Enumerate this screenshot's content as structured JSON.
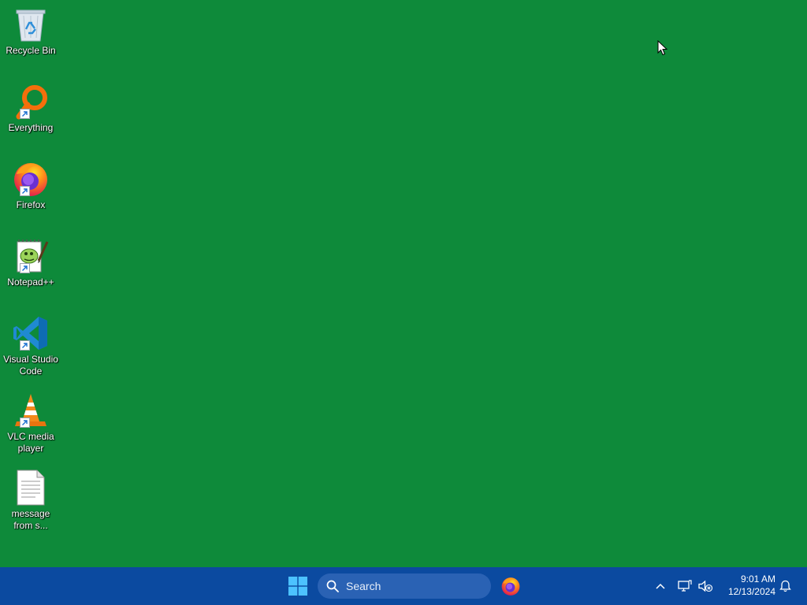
{
  "desktop": {
    "background_color": "#0e8a3a",
    "icons": [
      {
        "label": "Recycle Bin",
        "icon": "recycle-bin-icon",
        "shortcut": false
      },
      {
        "label": "Everything",
        "icon": "everything-search-icon",
        "shortcut": true
      },
      {
        "label": "Firefox",
        "icon": "firefox-icon",
        "shortcut": true
      },
      {
        "label": "Notepad++",
        "icon": "notepad-plus-plus-icon",
        "shortcut": true
      },
      {
        "label": "Visual Studio Code",
        "icon": "vscode-icon",
        "shortcut": true
      },
      {
        "label": "VLC media player",
        "icon": "vlc-icon",
        "shortcut": true
      },
      {
        "label": "message from s...",
        "icon": "text-document-icon",
        "shortcut": false
      }
    ]
  },
  "taskbar": {
    "background_color": "#0b4aa0",
    "start_icon": "windows-start-icon",
    "search": {
      "label": "Search",
      "icon": "search-icon"
    },
    "pinned": [
      {
        "name": "Firefox",
        "icon": "firefox-icon"
      }
    ],
    "tray": {
      "chevron_icon": "chevron-up-icon",
      "network_icon": "network-icon",
      "volume_icon": "volume-muted-icon",
      "notification_icon": "bell-icon",
      "time": "9:01 AM",
      "date": "12/13/2024"
    }
  }
}
